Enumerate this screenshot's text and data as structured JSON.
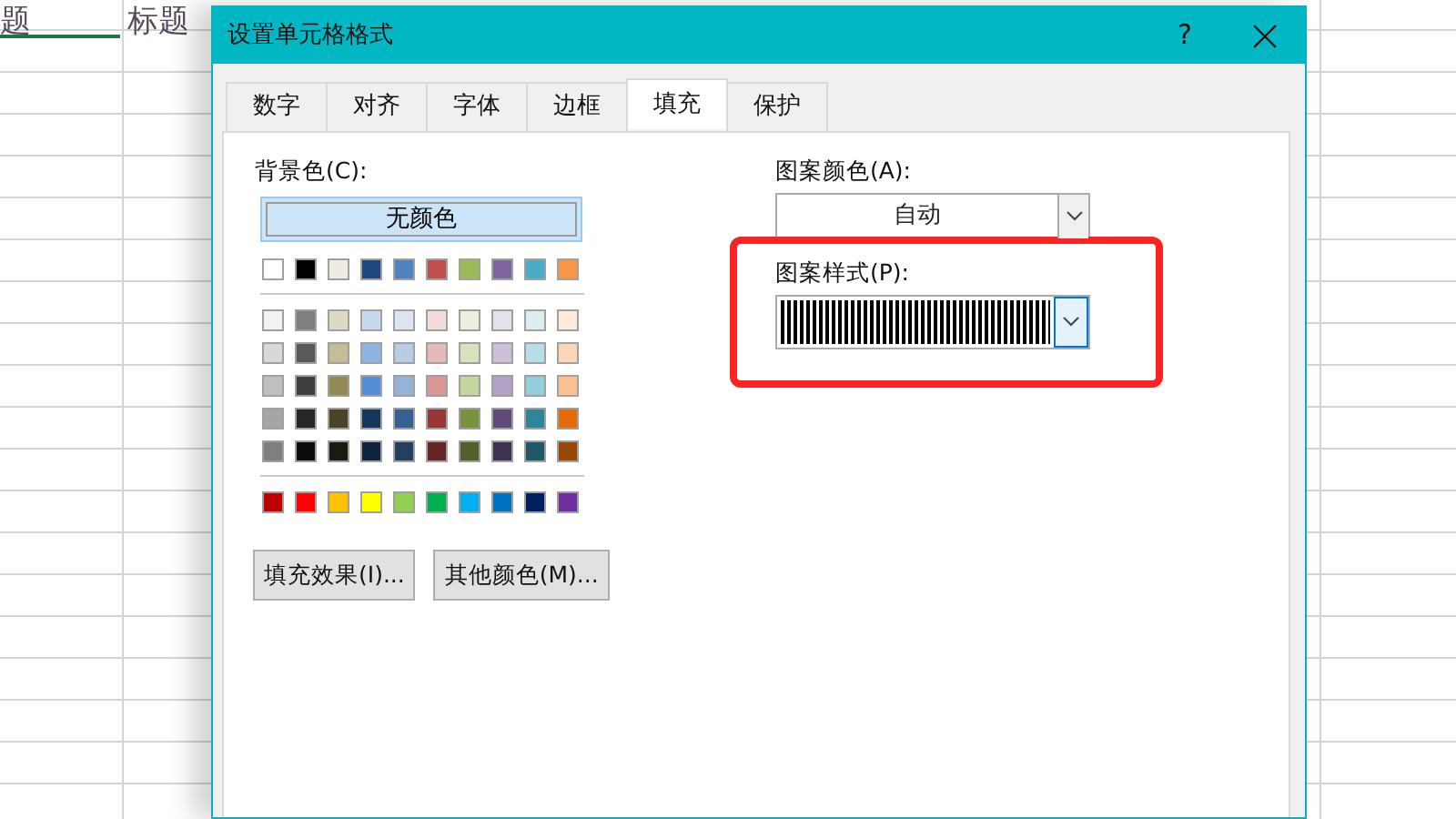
{
  "sheet": {
    "cells": [
      {
        "text": "题",
        "selected": true
      },
      {
        "text": "标题",
        "selected": false
      }
    ]
  },
  "dialog": {
    "title": "设置单元格格式",
    "help": "?",
    "tabs": [
      {
        "label": "数字",
        "selected": false
      },
      {
        "label": "对齐",
        "selected": false
      },
      {
        "label": "字体",
        "selected": false
      },
      {
        "label": "边框",
        "selected": false
      },
      {
        "label": "填充",
        "selected": true
      },
      {
        "label": "保护",
        "selected": false
      }
    ],
    "background_color": {
      "label": "背景色(C):",
      "no_color": {
        "label": "无颜色",
        "selected": true
      },
      "swatch_groups": [
        {
          "rows": [
            [
              {
                "color": "#ffffff"
              },
              {
                "color": "#000000"
              },
              {
                "color": "#eeece1"
              },
              {
                "color": "#1f497d"
              },
              {
                "color": "#4f81bd"
              },
              {
                "color": "#c0504d"
              },
              {
                "color": "#9bbb59"
              },
              {
                "color": "#8064a2"
              },
              {
                "color": "#4bacc6"
              },
              {
                "color": "#f79646"
              }
            ]
          ]
        },
        {
          "rows": [
            [
              {
                "color": "#f2f2f2"
              },
              {
                "color": "#7f7f7f"
              },
              {
                "color": "#ddd9c3"
              },
              {
                "color": "#c6d9f0"
              },
              {
                "color": "#dbe5f1"
              },
              {
                "color": "#f2dcdb"
              },
              {
                "color": "#ebf1dd"
              },
              {
                "color": "#e5e0ec"
              },
              {
                "color": "#dbeef3"
              },
              {
                "color": "#fdeada"
              }
            ],
            [
              {
                "color": "#d8d8d8"
              },
              {
                "color": "#595959"
              },
              {
                "color": "#c4bd97"
              },
              {
                "color": "#8db3e2"
              },
              {
                "color": "#b8cce4"
              },
              {
                "color": "#e5b9b7"
              },
              {
                "color": "#d7e3bc"
              },
              {
                "color": "#ccc1d9"
              },
              {
                "color": "#b7dde8"
              },
              {
                "color": "#fbd5b5"
              }
            ],
            [
              {
                "color": "#bfbfbf"
              },
              {
                "color": "#3f3f3f"
              },
              {
                "color": "#938953"
              },
              {
                "color": "#548dd4"
              },
              {
                "color": "#95b3d7"
              },
              {
                "color": "#d99694"
              },
              {
                "color": "#c3d69b"
              },
              {
                "color": "#b2a2c7"
              },
              {
                "color": "#92cddc"
              },
              {
                "color": "#fac08f"
              }
            ],
            [
              {
                "color": "#a5a5a5"
              },
              {
                "color": "#262626"
              },
              {
                "color": "#494429"
              },
              {
                "color": "#17365d"
              },
              {
                "color": "#366092"
              },
              {
                "color": "#953734"
              },
              {
                "color": "#76923c"
              },
              {
                "color": "#5f497a"
              },
              {
                "color": "#31859b"
              },
              {
                "color": "#e36c09"
              }
            ],
            [
              {
                "color": "#7f7f7f"
              },
              {
                "color": "#0c0c0c"
              },
              {
                "color": "#1d1b10"
              },
              {
                "color": "#0f243e"
              },
              {
                "color": "#244061"
              },
              {
                "color": "#632423"
              },
              {
                "color": "#4f6128"
              },
              {
                "color": "#3f3151"
              },
              {
                "color": "#205867"
              },
              {
                "color": "#974806"
              }
            ]
          ]
        },
        {
          "rows": [
            [
              {
                "color": "#c00000"
              },
              {
                "color": "#ff0000"
              },
              {
                "color": "#ffc000"
              },
              {
                "color": "#ffff00"
              },
              {
                "color": "#92d050"
              },
              {
                "color": "#00b050"
              },
              {
                "color": "#00b0f0"
              },
              {
                "color": "#0070c0"
              },
              {
                "color": "#002060"
              },
              {
                "color": "#7030a0"
              }
            ]
          ]
        }
      ],
      "buttons": [
        "填充效果(I)...",
        "其他颜色(M)..."
      ]
    },
    "pattern_color": {
      "label": "图案颜色(A):",
      "value": "自动"
    },
    "pattern_style": {
      "label": "图案样式(P):",
      "kind": "vertical-stripes",
      "highlighted": true
    }
  }
}
